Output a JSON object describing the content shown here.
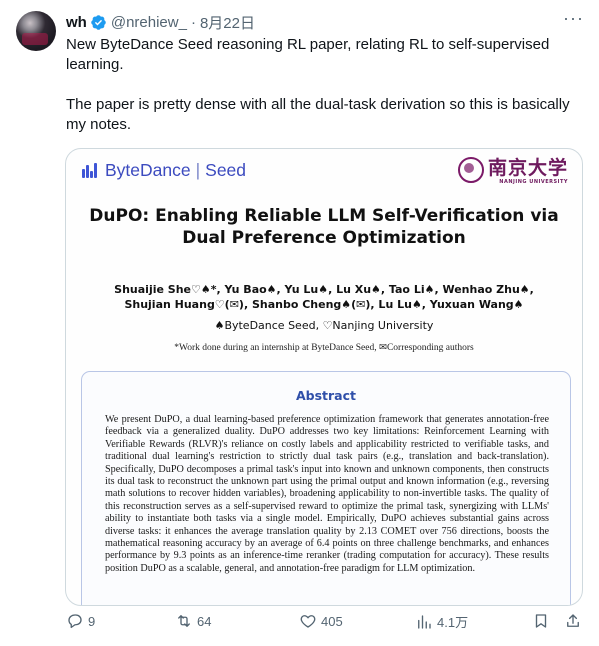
{
  "tweet": {
    "display_name": "wh",
    "handle": "@nrehiew_",
    "separator": "·",
    "date": "8月22日",
    "more_label": "···",
    "text_lines": [
      "New ByteDance Seed reasoning RL paper, relating RL to self-supervised learning.",
      "The paper is pretty dense with all the dual-task derivation so this is basically my notes."
    ]
  },
  "paper": {
    "brand_left": "ByteDance",
    "brand_sep": "|",
    "brand_right": "Seed",
    "nju_name": "南京大学",
    "nju_sub": "NANJING UNIVERSITY",
    "title": "DuPO: Enabling Reliable LLM Self-Verification via Dual Preference Optimization",
    "authors_line1": "Shuaijie She♡♠*, Yu Bao♠, Yu Lu♠, Lu Xu♠, Tao Li♠, Wenhao Zhu♠,",
    "authors_line2": "Shujian Huang♡(✉), Shanbo Cheng♠(✉), Lu Lu♠, Yuxuan Wang♠",
    "affiliations": "♠ByteDance Seed, ♡Nanjing University",
    "footnote": "*Work done during an internship at ByteDance Seed, ✉Corresponding authors",
    "abstract_title": "Abstract",
    "abstract_text": "We present DuPO, a dual learning-based preference optimization framework that generates annotation-free feedback via a generalized duality. DuPO addresses two key limitations: Reinforcement Learning with Verifiable Rewards (RLVR)'s reliance on costly labels and applicability restricted to verifiable tasks, and traditional dual learning's restriction to strictly dual task pairs (e.g., translation and back-translation). Specifically, DuPO decomposes a primal task's input into known and unknown components, then constructs its dual task to reconstruct the unknown part using the primal output and known information (e.g., reversing math solutions to recover hidden variables), broadening applicability to non-invertible tasks. The quality of this reconstruction serves as a self-supervised reward to optimize the primal task, synergizing with LLMs' ability to instantiate both tasks via a single model. Empirically, DuPO achieves substantial gains across diverse tasks: it enhances the average translation quality by 2.13 COMET over 756 directions, boosts the mathematical reasoning accuracy by an average of 6.4 points on three challenge benchmarks, and enhances performance by 9.3 points as an inference-time reranker (trading computation for accuracy). These results position DuPO as a scalable, general, and annotation-free paradigm for LLM optimization."
  },
  "actions": {
    "reply_count": "9",
    "repost_count": "64",
    "like_count": "405",
    "views_count": "4.1万"
  },
  "colors": {
    "accent_blue": "#1d9bf0",
    "text_secondary": "#536471",
    "bytedance_blue": "#3e55d6",
    "nju_purple": "#6e1a5e"
  },
  "icons": [
    "verified-badge-icon",
    "more-icon",
    "reply-icon",
    "repost-icon",
    "like-icon",
    "views-icon",
    "bookmark-icon",
    "share-icon"
  ]
}
